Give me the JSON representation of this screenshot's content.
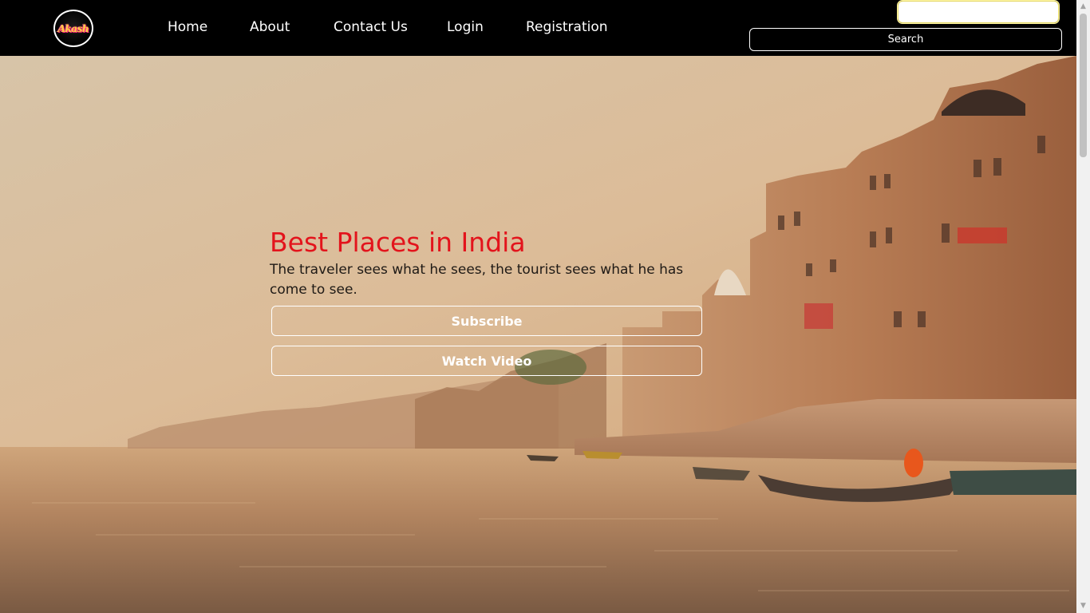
{
  "logo": {
    "text": "Akash"
  },
  "nav": {
    "home": "Home",
    "about": "About",
    "contact": "Contact Us",
    "login": "Login",
    "registration": "Registration"
  },
  "search": {
    "value": "",
    "placeholder": "",
    "button_label": "Search"
  },
  "hero": {
    "title": "Best Places in India",
    "subtitle": "The traveler sees what he sees, the tourist sees what he has come to see.",
    "subscribe_label": "Subscribe",
    "watch_label": "Watch Video",
    "title_color": "#e3141c"
  },
  "icons": {
    "scroll_up": "triangle-up-icon",
    "scroll_down": "triangle-down-icon"
  }
}
